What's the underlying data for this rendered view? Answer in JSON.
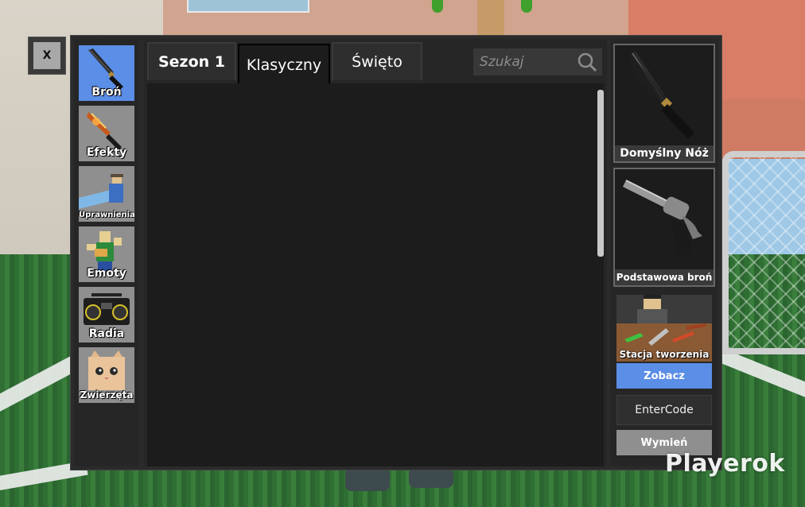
{
  "close_button": {
    "label": "X"
  },
  "categories": [
    {
      "label": "Broń",
      "icon": "knife-icon",
      "active": true
    },
    {
      "label": "Efekty",
      "icon": "flame-knife-icon",
      "active": false
    },
    {
      "label": "Uprawnienia",
      "icon": "character-perk-icon",
      "active": false
    },
    {
      "label": "Emoty",
      "icon": "dancing-character-icon",
      "active": false
    },
    {
      "label": "Radia",
      "icon": "boombox-icon",
      "active": false
    },
    {
      "label": "Zwierzęta",
      "icon": "cat-pet-icon",
      "active": false
    }
  ],
  "tabs": [
    {
      "label": "Sezon 1",
      "active": false
    },
    {
      "label": "Klasyczny",
      "active": true
    },
    {
      "label": "Święto",
      "active": false
    }
  ],
  "search": {
    "placeholder": "Szukaj"
  },
  "equipped": {
    "knife": {
      "label": "Domyślny Nóż",
      "icon": "default-knife-icon"
    },
    "gun": {
      "label": "Podstawowa broń",
      "icon": "revolver-icon"
    }
  },
  "crafting": {
    "label": "Stacja tworzenia",
    "button": "Zobacz"
  },
  "enter_code": {
    "placeholder": "EnterCode"
  },
  "trade_button": {
    "label": "Wymień"
  },
  "watermark": "Playerok",
  "colors": {
    "accent": "#5b8ee6",
    "panel": "#2b2b2b",
    "content": "#1c1c1c",
    "inactive_button": "#8f8f8f"
  }
}
